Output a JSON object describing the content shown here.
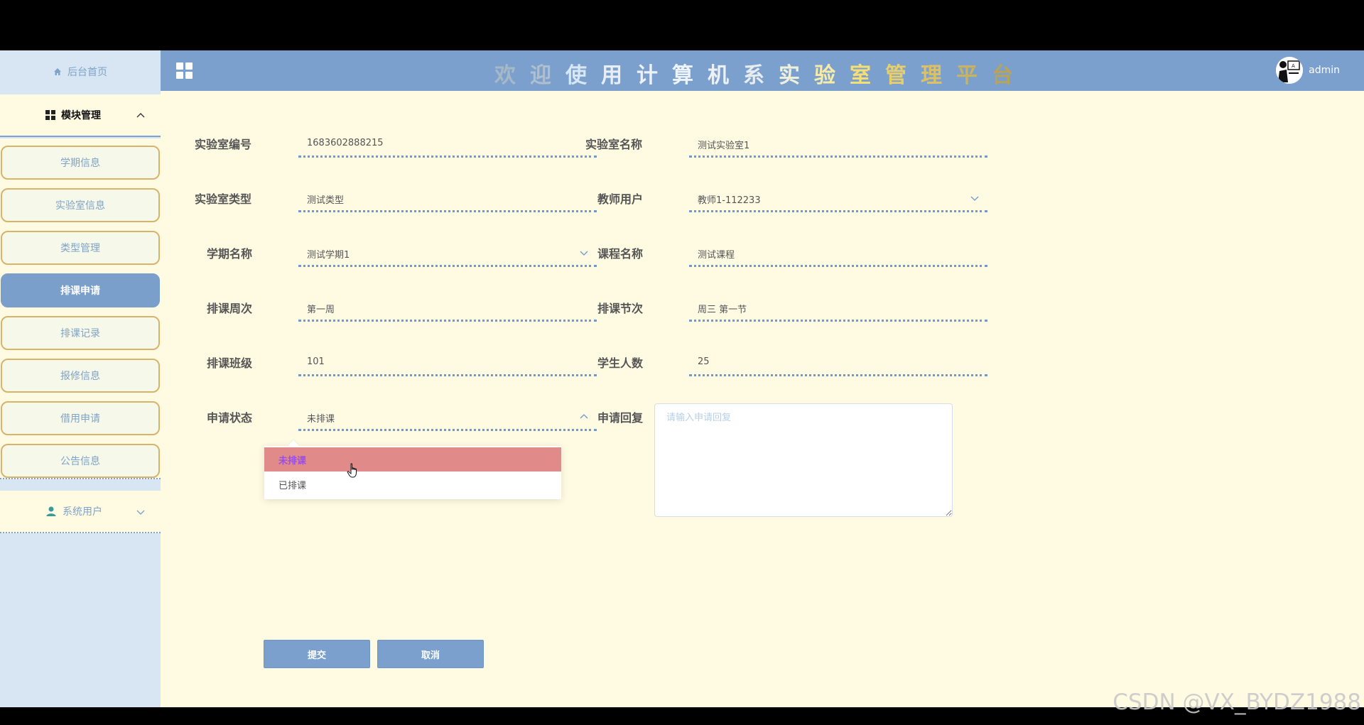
{
  "header": {
    "title_chars": [
      {
        "ch": "欢",
        "color": "#a7b8c6"
      },
      {
        "ch": "迎",
        "color": "#aebfd0"
      },
      {
        "ch": "使",
        "color": "#d8e7f4"
      },
      {
        "ch": "用",
        "color": "#e6eef7"
      },
      {
        "ch": "计",
        "color": "#edf2f7"
      },
      {
        "ch": "算",
        "color": "#eef3f8"
      },
      {
        "ch": "机",
        "color": "#edf1f6"
      },
      {
        "ch": "系",
        "color": "#e7ecef"
      },
      {
        "ch": "实",
        "color": "#eef0dc"
      },
      {
        "ch": "验",
        "color": "#f6eba8"
      },
      {
        "ch": "室",
        "color": "#f5df75"
      },
      {
        "ch": "管",
        "color": "#e9cf6a"
      },
      {
        "ch": "理",
        "color": "#dcc066"
      },
      {
        "ch": "平",
        "color": "#c9b260"
      },
      {
        "ch": "台",
        "color": "#b7a45a"
      }
    ],
    "user_name": "admin",
    "grid_icon": "grid-icon"
  },
  "sidebar": {
    "home_label": "后台首页",
    "module_label": "模块管理",
    "items": [
      {
        "label": "学期信息",
        "active": false
      },
      {
        "label": "实验室信息",
        "active": false
      },
      {
        "label": "类型管理",
        "active": false
      },
      {
        "label": "排课申请",
        "active": true
      },
      {
        "label": "排课记录",
        "active": false
      },
      {
        "label": "报修信息",
        "active": false
      },
      {
        "label": "借用申请",
        "active": false
      },
      {
        "label": "公告信息",
        "active": false
      }
    ],
    "system_label": "系统用户"
  },
  "form": {
    "lab_no": {
      "label": "实验室编号",
      "value": "1683602888215"
    },
    "lab_name": {
      "label": "实验室名称",
      "value": "测试实验室1"
    },
    "lab_type": {
      "label": "实验室类型",
      "value": "测试类型"
    },
    "teacher": {
      "label": "教师用户",
      "value": "教师1-112233"
    },
    "term": {
      "label": "学期名称",
      "value": "测试学期1"
    },
    "course": {
      "label": "课程名称",
      "value": "测试课程"
    },
    "week": {
      "label": "排课周次",
      "value": "第一周"
    },
    "section": {
      "label": "排课节次",
      "value": "周三 第一节"
    },
    "class": {
      "label": "排课班级",
      "value": "101"
    },
    "students": {
      "label": "学生人数",
      "value": "25"
    },
    "status": {
      "label": "申请状态",
      "value": "未排课",
      "options": [
        "未排课",
        "已排课"
      ]
    },
    "reply": {
      "label": "申请回复",
      "placeholder": "请输入申请回复"
    },
    "submit_label": "提交",
    "cancel_label": "取消"
  },
  "watermark": "CSDN @VX_BYDZ1988",
  "colors": {
    "header": "#7ba0cd",
    "sidebar": "#d8e6f4",
    "main": "#fffbe3",
    "active_item": "#7a9fcb",
    "selected_option": "#e08a8a"
  }
}
